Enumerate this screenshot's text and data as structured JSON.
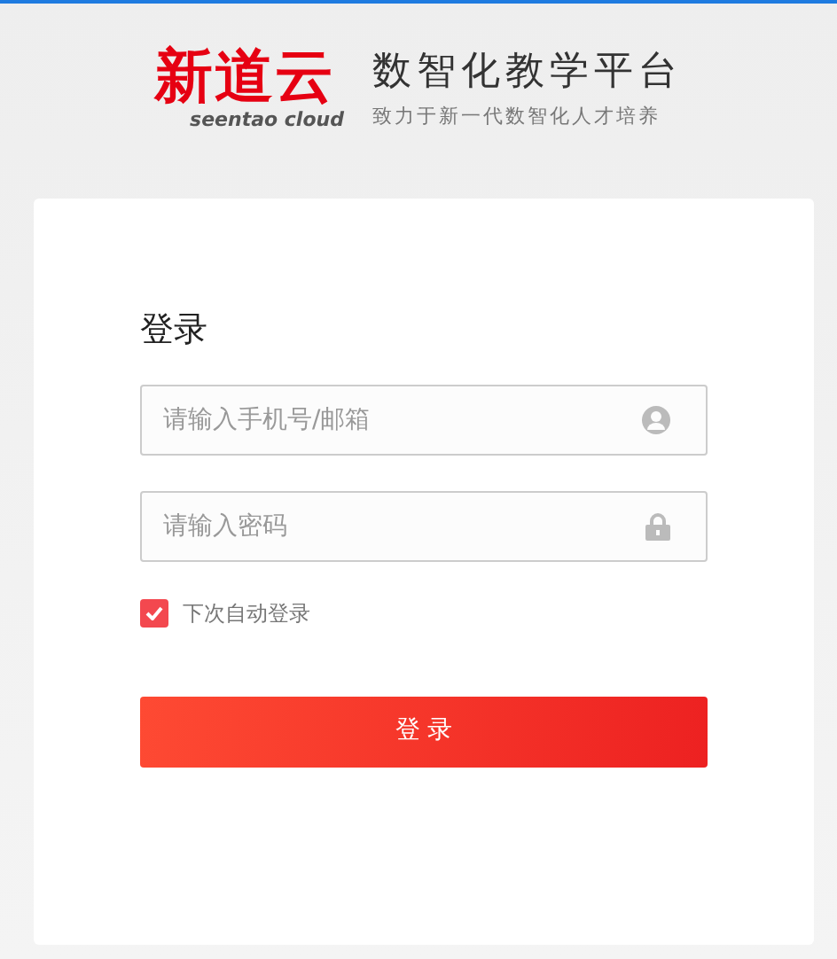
{
  "header": {
    "logo_text": "新道云",
    "logo_subtext": "seentao cloud",
    "title": "数智化教学平台",
    "subtitle": "致力于新一代数智化人才培养"
  },
  "login": {
    "heading": "登录",
    "fields": [
      {
        "kind": "account",
        "placeholder": "请输入手机号/邮箱"
      },
      {
        "kind": "password",
        "placeholder": "请输入密码"
      }
    ],
    "remember": {
      "label": "下次自动登录",
      "checked": true
    },
    "submit": "登 录"
  }
}
